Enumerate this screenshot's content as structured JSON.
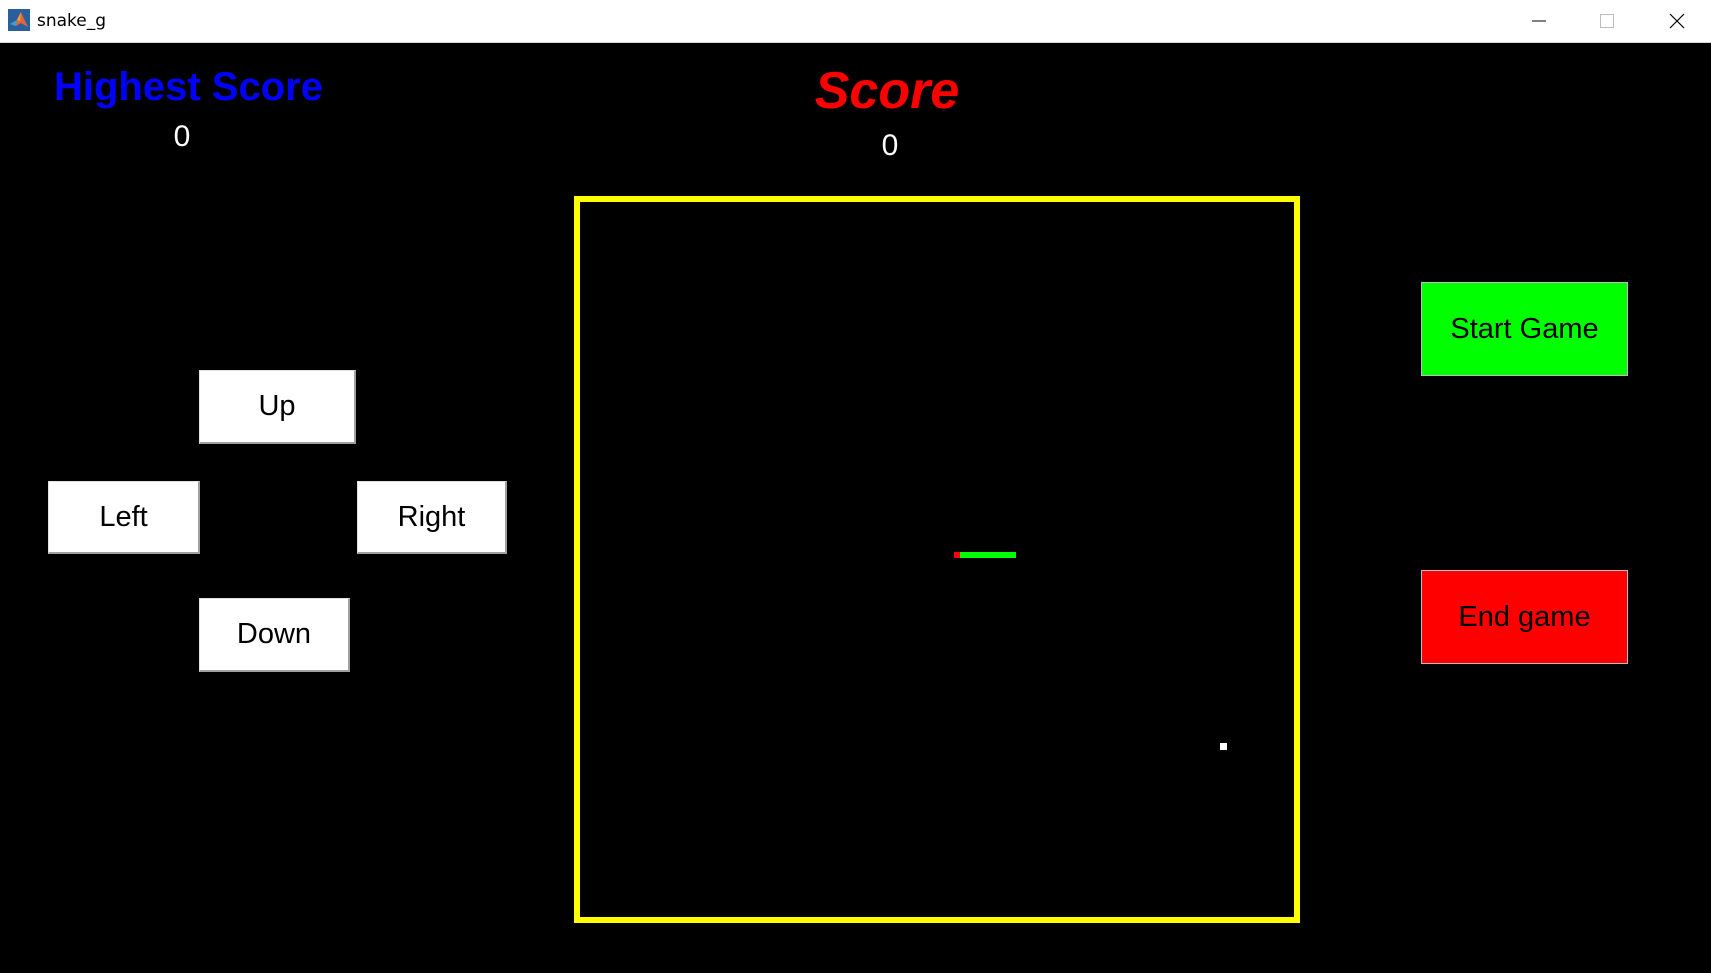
{
  "window": {
    "title": "snake_g",
    "icon": "matlab-icon",
    "controls": [
      "minimize-icon",
      "maximize-icon",
      "close-icon"
    ]
  },
  "scoreboard": {
    "highest_label": "Highest Score",
    "highest_value": "0",
    "score_label": "Score",
    "score_value": "0"
  },
  "direction_pad": {
    "up": "Up",
    "left": "Left",
    "right": "Right",
    "down": "Down"
  },
  "actions": {
    "start": "Start Game",
    "end": "End game"
  },
  "colors": {
    "background": "#000000",
    "highest_label": "#0000ff",
    "score_label": "#ff0000",
    "arena_border": "#ffff00",
    "snake_body": "#00ff00",
    "snake_head": "#ff0000",
    "food": "#ffffff",
    "start_button": "#00ff00",
    "end_button": "#ff0000"
  }
}
